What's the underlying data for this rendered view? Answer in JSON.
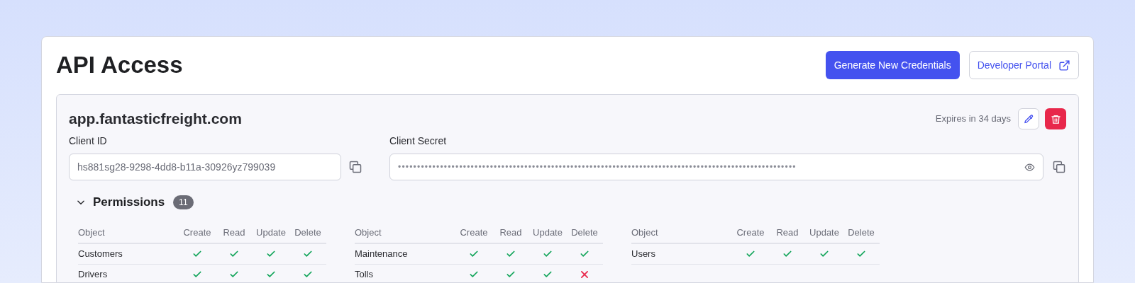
{
  "page": {
    "title": "API Access"
  },
  "header_buttons": [
    {
      "label": "Generate New Credentials",
      "kind": "primary"
    },
    {
      "label": "Developer Portal",
      "kind": "external"
    }
  ],
  "credential": {
    "domain": "app.fantasticfreight.com",
    "expires": "Expires in 34 days",
    "client_id": {
      "label": "Client ID",
      "value": "hs881sg28-9298-4dd8-b11a-30926yz799039"
    },
    "client_secret": {
      "label": "Client Secret",
      "value": "••••••••••••••••••••••••••••••••••••••••••••••••••••••••••••••••••••••••••••••••••••••••••••••••••••••••"
    }
  },
  "permissions": {
    "title": "Permissions",
    "count": "11",
    "expanded": true,
    "tables": [
      {
        "columns": [
          "Object",
          "Create",
          "Read",
          "Update",
          "Delete"
        ],
        "rows": [
          {
            "object": "Customers",
            "allowed": [
              true,
              true,
              true,
              true
            ]
          },
          {
            "object": "Drivers",
            "allowed": [
              true,
              true,
              true,
              true
            ]
          }
        ]
      },
      {
        "columns": [
          "Object",
          "Create",
          "Read",
          "Update",
          "Delete"
        ],
        "rows": [
          {
            "object": "Maintenance",
            "allowed": [
              true,
              true,
              true,
              true
            ]
          },
          {
            "object": "Tolls",
            "allowed": [
              true,
              true,
              true,
              false
            ]
          }
        ]
      },
      {
        "columns": [
          "Object",
          "Create",
          "Read",
          "Update",
          "Delete"
        ],
        "rows": [
          {
            "object": "Users",
            "allowed": [
              true,
              true,
              true,
              true
            ]
          }
        ]
      }
    ]
  }
}
